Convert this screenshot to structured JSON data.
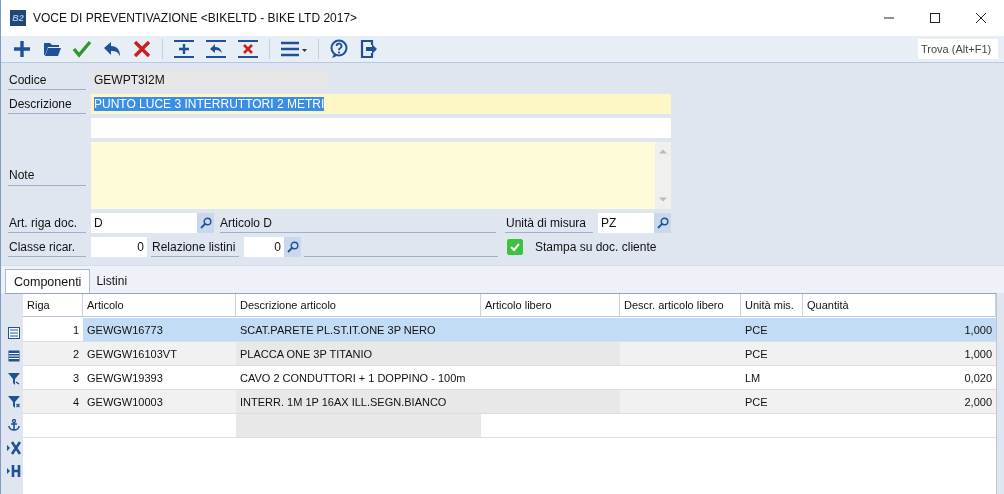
{
  "window": {
    "logo": "B2",
    "title": "VOCE DI PREVENTIVAZIONE <BIKELTD - BIKE LTD 2017>"
  },
  "toolbar": {
    "tools": [
      {
        "kind": "new"
      },
      {
        "kind": "open"
      },
      {
        "kind": "save"
      },
      {
        "kind": "undo"
      },
      {
        "kind": "delete"
      },
      {
        "kind": "separator"
      },
      {
        "kind": "row-add"
      },
      {
        "kind": "row-undo"
      },
      {
        "kind": "row-delete"
      },
      {
        "kind": "separator"
      },
      {
        "kind": "menu"
      },
      {
        "kind": "separator"
      },
      {
        "kind": "help"
      },
      {
        "kind": "exit"
      }
    ],
    "search": {
      "placeholder": "Trova (Alt+F1)"
    }
  },
  "form": {
    "codice": {
      "label": "Codice",
      "value": "GEWPT3I2M"
    },
    "descrizione": {
      "label": "Descrizione",
      "value": "PUNTO LUCE 3 INTERRUTTORI 2 METRI",
      "text_selected": true
    },
    "note": {
      "label": "Note"
    },
    "art_riga_doc": {
      "label": "Art. riga doc.",
      "value": "D",
      "description": "Articolo D"
    },
    "unita_misura": {
      "label": "Unità di misura",
      "value": "PZ"
    },
    "classe_ricar": {
      "label": "Classe ricar.",
      "value": "0"
    },
    "relazione_listini": {
      "label": "Relazione listini",
      "value": "0"
    },
    "stampa": {
      "label": "Stampa su doc. cliente",
      "checked": true
    }
  },
  "tabs": [
    {
      "label": "Componenti",
      "selected": true
    },
    {
      "label": "Listini",
      "selected": false
    }
  ],
  "grid": {
    "side_tools": [
      {
        "kind": "list"
      },
      {
        "kind": "table"
      },
      {
        "kind": "filter"
      },
      {
        "kind": "filter-clear"
      },
      {
        "kind": "anchor"
      },
      {
        "kind": "delete-row"
      },
      {
        "kind": "header"
      }
    ],
    "columns": [
      "Riga",
      "Articolo",
      "Descrizione articolo",
      "Articolo libero",
      "Descr. articolo libero",
      "Unità mis.",
      "Quantità"
    ],
    "rows": [
      {
        "riga": "1",
        "articolo": "GEWGW16773",
        "descrizione": "SCAT.PARETE PL.ST.IT.ONE 3P NERO",
        "unita": "PCE",
        "quantita": "1,000",
        "selected": true
      },
      {
        "riga": "2",
        "articolo": "GEWGW16103VT",
        "descrizione": "PLACCA ONE 3P TITANIO",
        "unita": "PCE",
        "quantita": "1,000",
        "selected": false
      },
      {
        "riga": "3",
        "articolo": "GEWGW19393",
        "descrizione": "CAVO 2 CONDUTTORI + 1 DOPPINO - 100m",
        "unita": "LM",
        "quantita": "0,020",
        "selected": false
      },
      {
        "riga": "4",
        "articolo": "GEWGW10003",
        "descrizione": "INTERR. 1M 1P 16AX ILL.SEGN.BIANCO",
        "unita": "PCE",
        "quantita": "2,000",
        "selected": false
      }
    ]
  }
}
